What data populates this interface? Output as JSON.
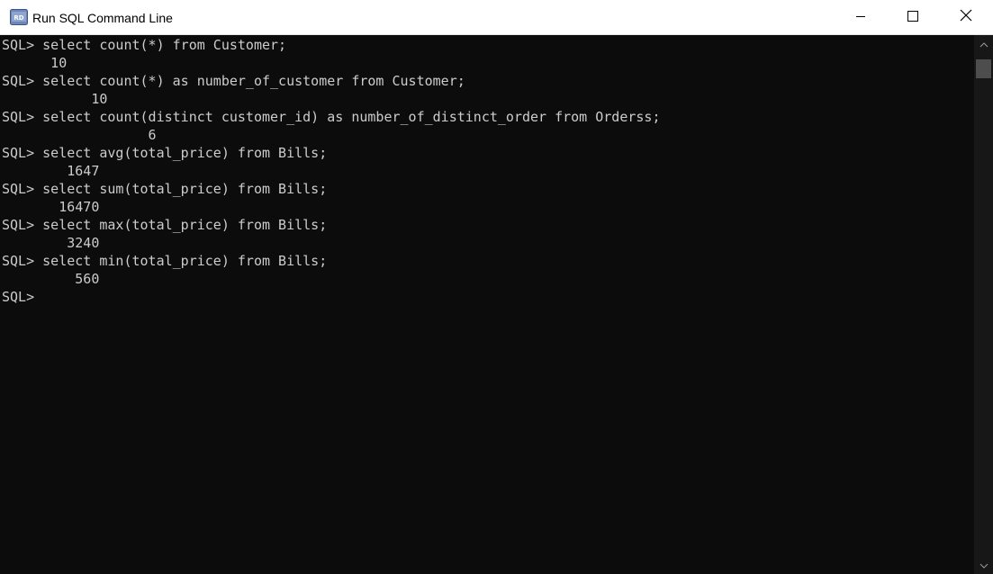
{
  "window": {
    "title": "Run SQL Command Line",
    "icon": "sql-icon",
    "controls": [
      "minimize-icon",
      "maximize-icon",
      "close-icon"
    ]
  },
  "colors": {
    "console_bg": "#0c0c0c",
    "console_text": "#cccccc",
    "titlebar_bg": "#ffffff"
  },
  "console": {
    "lines": [
      "SQL> select count(*) from Customer;",
      "      10",
      "SQL> select count(*) as number_of_customer from Customer;",
      "           10",
      "SQL> select count(distinct customer_id) as number_of_distinct_order from Orderss;",
      "                  6",
      "SQL> select avg(total_price) from Bills;",
      "        1647",
      "SQL> select sum(total_price) from Bills;",
      "       16470",
      "SQL> select max(total_price) from Bills;",
      "        3240",
      "SQL> select min(total_price) from Bills;",
      "         560",
      "",
      "SQL>"
    ]
  }
}
